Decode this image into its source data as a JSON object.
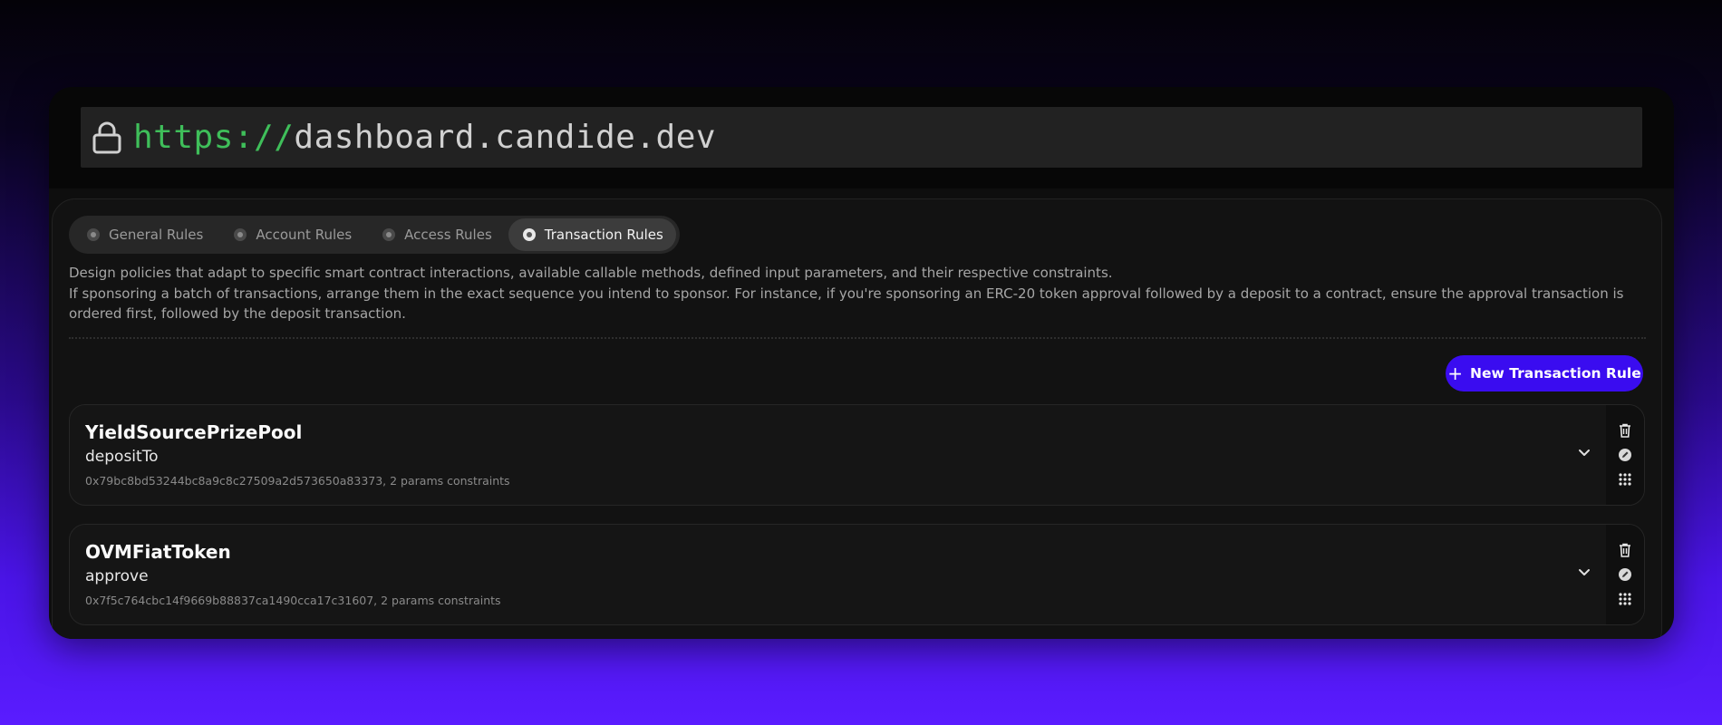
{
  "browser": {
    "url_scheme": "https://",
    "url_host": "dashboard.candide.dev"
  },
  "tabs": [
    {
      "label": "General Rules",
      "icon": "general-rules-icon",
      "active": false
    },
    {
      "label": "Account Rules",
      "icon": "account-rules-icon",
      "active": false
    },
    {
      "label": "Access Rules",
      "icon": "access-rules-icon",
      "active": false
    },
    {
      "label": "Transaction Rules",
      "icon": "transaction-rules-icon",
      "active": true
    }
  ],
  "description": {
    "line1": "Design policies that adapt to specific smart contract interactions, available callable methods, defined input parameters, and their respective constraints.",
    "line2": "If sponsoring a batch of transactions, arrange them in the exact sequence you intend to sponsor. For instance, if you're sponsoring an ERC-20 token approval followed by a deposit to a contract, ensure the approval transaction is ordered first, followed by the deposit transaction."
  },
  "new_rule_button": {
    "label": "New Transaction Rule",
    "icon": "plus-icon"
  },
  "rules": [
    {
      "contract": "YieldSourcePrizePool",
      "method": "depositTo",
      "meta": "0x79bc8bd53244bc8a9c8c27509a2d573650a83373, 2 params constraints"
    },
    {
      "contract": "OVMFiatToken",
      "method": "approve",
      "meta": "0x7f5c764cbc14f9669b88837ca1490cca17c31607, 2 params constraints"
    }
  ],
  "colors": {
    "accent": "#3a0cf0",
    "url_scheme": "#3fbf5a"
  }
}
